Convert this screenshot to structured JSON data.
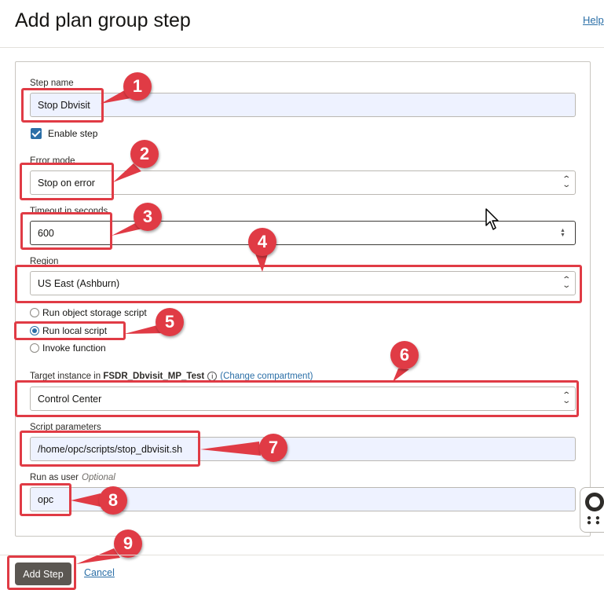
{
  "header": {
    "title": "Add plan group step",
    "help_link": "Help"
  },
  "form": {
    "step_name": {
      "label": "Step name",
      "value": "Stop Dbvisit"
    },
    "enable_step": {
      "label": "Enable step",
      "checked": true
    },
    "error_mode": {
      "label": "Error mode",
      "value": "Stop on error"
    },
    "timeout": {
      "label": "Timeout in seconds",
      "value": "600"
    },
    "region": {
      "label": "Region",
      "value": "US East (Ashburn)"
    },
    "script_type": {
      "options": [
        "Run object storage script",
        "Run local script",
        "Invoke function"
      ],
      "selected": "Run local script"
    },
    "target_instance": {
      "label_prefix": "Target instance in",
      "compartment": "FSDR_Dbvisit_MP_Test",
      "change_link": "(Change compartment)",
      "value": "Control Center"
    },
    "script_parameters": {
      "label": "Script parameters",
      "value": "/home/opc/scripts/stop_dbvisit.sh"
    },
    "run_as_user": {
      "label": "Run as user",
      "optional": "Optional",
      "value": "opc"
    }
  },
  "footer": {
    "add_button": "Add Step",
    "cancel_link": "Cancel"
  },
  "annotations": [
    "1",
    "2",
    "3",
    "4",
    "5",
    "6",
    "7",
    "8",
    "9"
  ],
  "colors": {
    "accent": "#2b6fa7",
    "annotation": "#e03b45",
    "button": "#5b5752",
    "field_bg": "#eef2ff"
  },
  "icons": [
    "info-icon",
    "select-arrows-icon",
    "spinner-icon",
    "checkmark-icon",
    "lifebuoy-icon",
    "grid-dots-icon",
    "mouse-pointer-icon"
  ]
}
